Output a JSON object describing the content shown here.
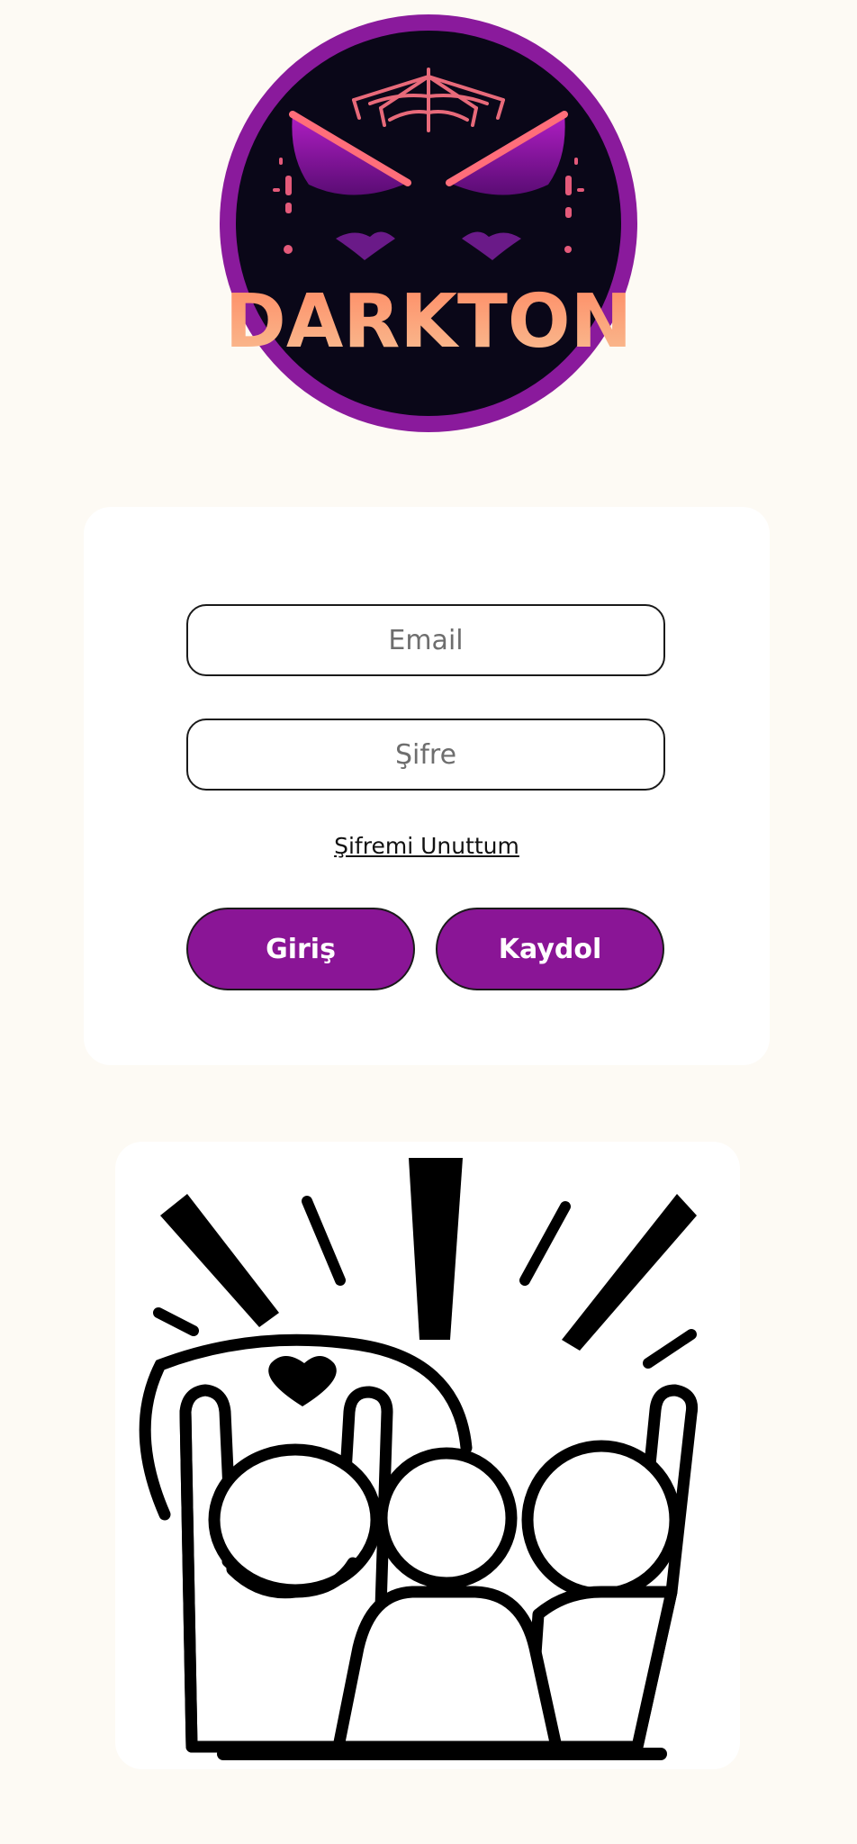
{
  "logo": {
    "text": "DARKTON",
    "colors": {
      "ring": "#8a1a9c",
      "inner": "#0a0718",
      "accent_pink": "#ff6a6a",
      "accent_purple": "#a020c0",
      "text_gradient_top": "#ff8f6a",
      "text_gradient_bottom": "#f7b98c"
    }
  },
  "form": {
    "email_placeholder": "Email",
    "password_placeholder": "Şifre",
    "forgot_password": "Şifremi Unuttum",
    "login_button": "Giriş",
    "register_button": "Kaydol"
  },
  "illustration": {
    "name": "celebrating-friends-illustration"
  },
  "theme": {
    "background": "#fdfaf4",
    "button_color": "#8a1596",
    "button_text": "#ffffff"
  }
}
